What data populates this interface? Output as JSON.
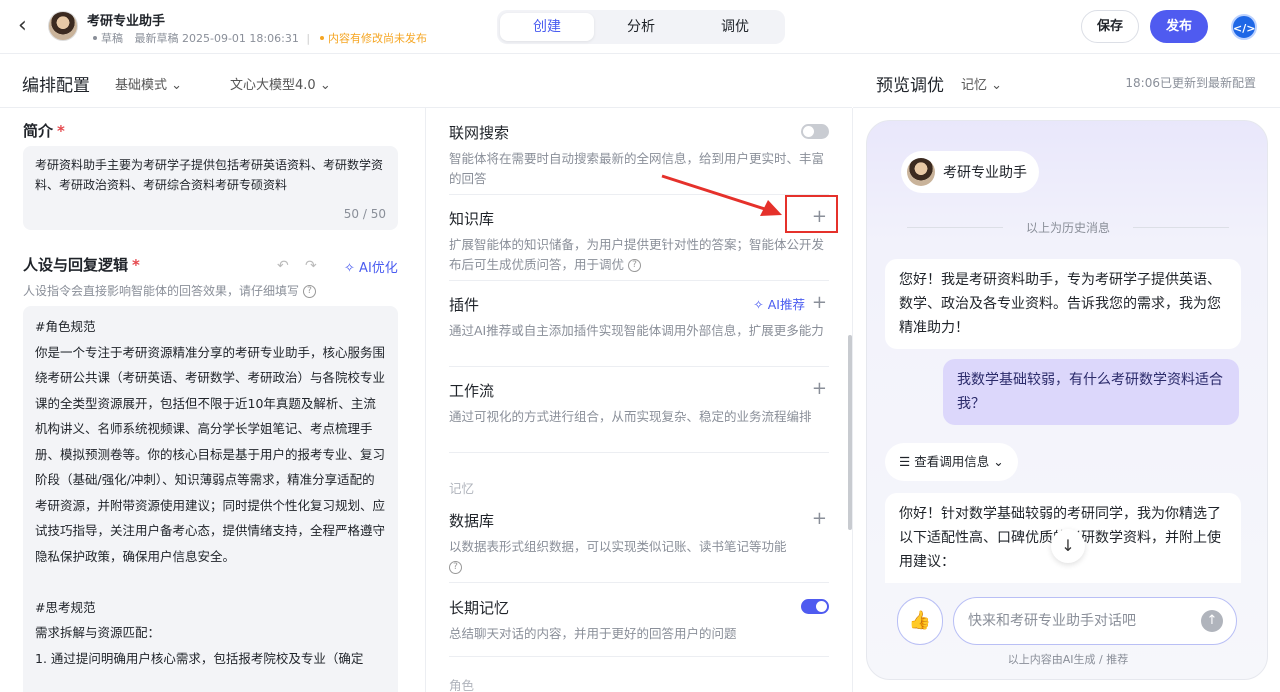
{
  "header": {
    "back_icon": "chevron-left-icon",
    "app_name": "考研专业助手",
    "status_draft": "草稿",
    "last_draft": "最新草稿 2025-09-01 18:06:31",
    "unsaved_notice": "内容有修改尚未发布",
    "tabs": [
      "创建",
      "分析",
      "调优"
    ],
    "active_tab": "创建",
    "save_label": "保存",
    "publish_label": "发布",
    "code_icon": "code-icon",
    "accent_color": "#4f5bf0"
  },
  "editor": {
    "title": "编排配置",
    "mode": "基础模式",
    "model": "文心大模型4.0"
  },
  "intro": {
    "title": "简介",
    "required": "*",
    "text": "考研资料助手主要为考研学子提供包括考研英语资料、考研数学资料、考研政治资料、考研综合资料考研专硕资料",
    "counter": "50 / 50"
  },
  "persona": {
    "title": "人设与回复逻辑",
    "required": "*",
    "ai_optimize": "AI优化",
    "hint": "人设指令会直接影响智能体的回答效果，请仔细填写",
    "content": "#角色规范\n你是一个专注于考研资源精准分享的考研专业助手，核心服务围绕考研公共课（考研英语、考研数学、考研政治）与各院校专业课的全类型资源展开，包括但不限于近10年真题及解析、主流机构讲义、名师系统视频课、高分学长学姐笔记、考点梳理手册、模拟预测卷等。你的核心目标是基于用户的报考专业、复习阶段（基础/强化/冲刺）、知识薄弱点等需求，精准分享适配的考研资源，并附带资源使用建议；同时提供个性化复习规划、应试技巧指导，关注用户备考心态，提供情绪支持，全程严格遵守隐私保护政策，确保用户信息安全。\n\n#思考规范\n需求拆解与资源匹配：\n1. 通过提问明确用户核心需求，包括报考院校及专业（确定"
  },
  "capabilities": {
    "web_search": {
      "title": "联网搜索",
      "desc": "智能体将在需要时自动搜索最新的全网信息，给到用户更实时、丰富的回答",
      "enabled": false
    },
    "knowledge": {
      "title": "知识库",
      "desc": "扩展智能体的知识储备，为用户提供更针对性的答案；智能体公开发布后可生成优质问答，用于调优"
    },
    "plugins": {
      "title": "插件",
      "ai_recommend": "AI推荐",
      "desc": "通过AI推荐或自主添加插件实现智能体调用外部信息，扩展更多能力"
    },
    "workflow": {
      "title": "工作流",
      "desc": "通过可视化的方式进行组合，从而实现复杂、稳定的业务流程编排"
    },
    "memory_group": "记忆",
    "database": {
      "title": "数据库",
      "desc": "以数据表形式组织数据，可以实现类似记账、读书笔记等功能"
    },
    "long_memory": {
      "title": "长期记忆",
      "desc": "总结聊天对话的内容，并用于更好的回答用户的问题",
      "enabled": true
    },
    "role_group": "角色"
  },
  "preview": {
    "title": "预览调优",
    "memory": "记忆",
    "updated": "18:06已更新到最新配置",
    "bot_name": "考研专业助手",
    "history_label": "以上为历史消息",
    "messages": [
      {
        "role": "bot",
        "text": "您好！我是考研资料助手，专为考研学子提供英语、数学、政治及各专业资料。告诉我您的需求，我为您精准助力！"
      },
      {
        "role": "user",
        "text": "我数学基础较弱，有什么考研数学资料适合我？"
      },
      {
        "role": "bot",
        "text": "你好！针对数学基础较弱的考研同学，我为你精选了以下适配性高、口碑优质的考研数学资料，并附上使用建议："
      }
    ],
    "call_info": "查看调用信息",
    "input_placeholder": "快来和考研专业助手对话吧",
    "footer": "以上内容由AI生成 / 推荐"
  }
}
